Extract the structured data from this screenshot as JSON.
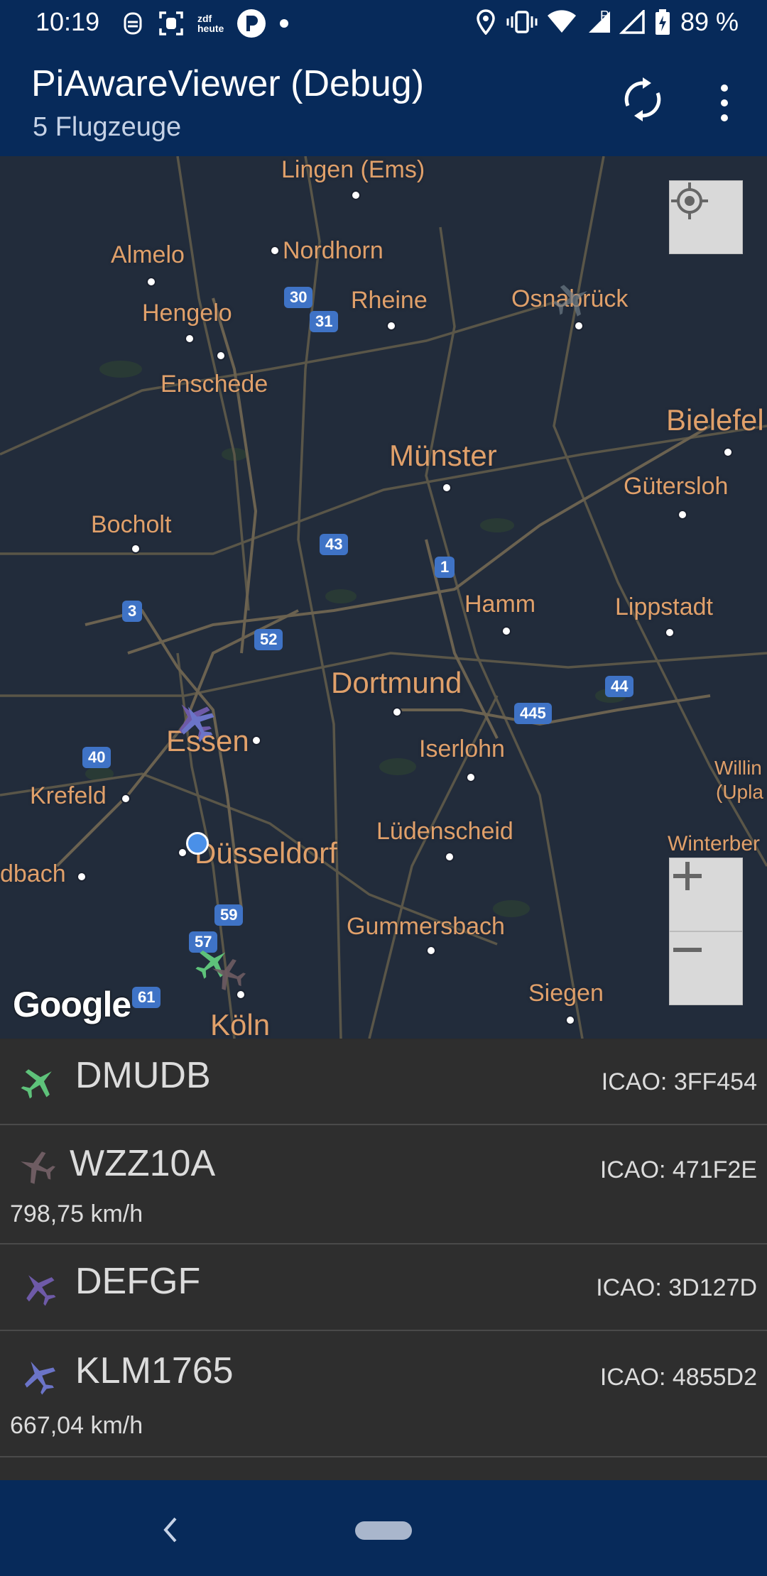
{
  "status_bar": {
    "time": "10:19",
    "battery": "89 %",
    "left_icons": [
      "face-unlock-icon",
      "screenshot-icon",
      "zdf-heute-icon",
      "pocketcasts-icon",
      "dot-icon"
    ],
    "right_icons": [
      "location-icon",
      "vibrate-icon",
      "wifi-icon",
      "signal-icon",
      "battery-icon"
    ],
    "zdf_line1": "zdf",
    "zdf_line2": "heute",
    "signal_r": "R"
  },
  "appbar": {
    "title": "PiAwareViewer (Debug)",
    "subtitle": "5 Flugzeuge",
    "icons": [
      "refresh-icon",
      "more-vert-icon"
    ]
  },
  "map": {
    "cities": {
      "lingen": "Lingen (Ems)",
      "nordhorn": "Nordhorn",
      "almelo": "Almelo",
      "hengelo": "Hengelo",
      "rheine": "Rheine",
      "osnabrueck": "Osnabrück",
      "enschede": "Enschede",
      "bielefeld": "Bielefel",
      "muenster": "Münster",
      "guetersloh": "Gütersloh",
      "bocholt": "Bocholt",
      "hamm": "Hamm",
      "lippstadt": "Lippstadt",
      "dortmund": "Dortmund",
      "essen": "Essen",
      "iserlohn": "Iserlohn",
      "krefeld": "Krefeld",
      "willingen1": "Willin",
      "willingen2": "(Upla",
      "winterberg": "Winterber",
      "luedenscheid": "Lüdenscheid",
      "moenchengladbach": "dbach",
      "duesseldorf": "Düsseldorf",
      "gummersbach": "Gummersbach",
      "siegen": "Siegen",
      "koeln": "Köln"
    },
    "highways": {
      "a30": "30",
      "a31": "31",
      "a43": "43",
      "a1": "1",
      "a3": "3",
      "a52": "52",
      "a44": "44",
      "a445": "445",
      "a40": "40",
      "a59": "59",
      "a57": "57",
      "a61": "61"
    },
    "logo": "Google",
    "controls": [
      "my-location-icon",
      "zoom-in-icon",
      "zoom-out-icon"
    ]
  },
  "aircraft": [
    {
      "callsign": "DMUDB",
      "icao": "ICAO: 3FF454",
      "speed": "",
      "color": "#5ec27a"
    },
    {
      "callsign": "WZZ10A",
      "icao": "ICAO: 471F2E",
      "speed": "798,75 km/h",
      "color": "#6e5c62"
    },
    {
      "callsign": "DEFGF",
      "icao": "ICAO: 3D127D",
      "speed": "",
      "color": "#6e5aa8"
    },
    {
      "callsign": "KLM1765",
      "icao": "ICAO: 4855D2",
      "speed": "667,04 km/h",
      "color": "#6b74c8"
    }
  ],
  "navbar": {
    "icons": [
      "back-icon",
      "home-pill"
    ]
  }
}
